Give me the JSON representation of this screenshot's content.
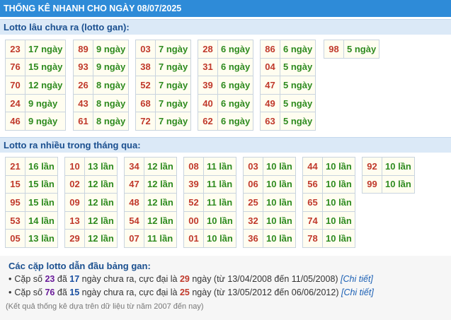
{
  "title": "THỐNG KÊ NHANH CHO NGÀY 08/07/2025",
  "gan_section": {
    "heading": "Lotto lâu chưa ra (lotto gan):",
    "groups": [
      [
        [
          "23",
          "17 ngày"
        ],
        [
          "76",
          "15 ngày"
        ],
        [
          "70",
          "12 ngày"
        ],
        [
          "24",
          "9 ngày"
        ],
        [
          "46",
          "9 ngày"
        ]
      ],
      [
        [
          "89",
          "9 ngày"
        ],
        [
          "93",
          "9 ngày"
        ],
        [
          "26",
          "8 ngày"
        ],
        [
          "43",
          "8 ngày"
        ],
        [
          "61",
          "8 ngày"
        ]
      ],
      [
        [
          "03",
          "7 ngày"
        ],
        [
          "38",
          "7 ngày"
        ],
        [
          "52",
          "7 ngày"
        ],
        [
          "68",
          "7 ngày"
        ],
        [
          "72",
          "7 ngày"
        ]
      ],
      [
        [
          "28",
          "6 ngày"
        ],
        [
          "31",
          "6 ngày"
        ],
        [
          "39",
          "6 ngày"
        ],
        [
          "40",
          "6 ngày"
        ],
        [
          "62",
          "6 ngày"
        ]
      ],
      [
        [
          "86",
          "6 ngày"
        ],
        [
          "04",
          "5 ngày"
        ],
        [
          "47",
          "5 ngày"
        ],
        [
          "49",
          "5 ngày"
        ],
        [
          "63",
          "5 ngày"
        ]
      ],
      [
        [
          "98",
          "5 ngày"
        ]
      ]
    ]
  },
  "frequent_section": {
    "heading": "Lotto ra nhiều trong tháng qua:",
    "groups": [
      [
        [
          "21",
          "16 lần"
        ],
        [
          "15",
          "15 lần"
        ],
        [
          "95",
          "15 lần"
        ],
        [
          "53",
          "14 lần"
        ],
        [
          "05",
          "13 lần"
        ]
      ],
      [
        [
          "10",
          "13 lần"
        ],
        [
          "02",
          "12 lần"
        ],
        [
          "09",
          "12 lần"
        ],
        [
          "13",
          "12 lần"
        ],
        [
          "29",
          "12 lần"
        ]
      ],
      [
        [
          "34",
          "12 lần"
        ],
        [
          "47",
          "12 lần"
        ],
        [
          "48",
          "12 lần"
        ],
        [
          "54",
          "12 lần"
        ],
        [
          "07",
          "11 lần"
        ]
      ],
      [
        [
          "08",
          "11 lần"
        ],
        [
          "39",
          "11 lần"
        ],
        [
          "52",
          "11 lần"
        ],
        [
          "00",
          "10 lần"
        ],
        [
          "01",
          "10 lần"
        ]
      ],
      [
        [
          "03",
          "10 lần"
        ],
        [
          "06",
          "10 lần"
        ],
        [
          "25",
          "10 lần"
        ],
        [
          "32",
          "10 lần"
        ],
        [
          "36",
          "10 lần"
        ]
      ],
      [
        [
          "44",
          "10 lần"
        ],
        [
          "56",
          "10 lần"
        ],
        [
          "65",
          "10 lần"
        ],
        [
          "74",
          "10 lần"
        ],
        [
          "78",
          "10 lần"
        ]
      ],
      [
        [
          "92",
          "10 lần"
        ],
        [
          "99",
          "10 lần"
        ]
      ]
    ]
  },
  "summary": {
    "heading": "Các cặp lotto dẫn đầu bảng gan:",
    "lines": [
      {
        "pre": "Cặp số ",
        "num": "23",
        "mid1": " đã ",
        "days": "17",
        "mid2": " ngày chưa ra, cực đại là ",
        "max": "29",
        "post": " ngày (từ 13/04/2008 đến 11/05/2008) ",
        "link": "[Chi tiết]"
      },
      {
        "pre": "Cặp số ",
        "num": "76",
        "mid1": " đã ",
        "days": "15",
        "mid2": " ngày chưa ra, cực đại là ",
        "max": "25",
        "post": " ngày (từ 13/05/2012 đến 06/06/2012) ",
        "link": "[Chi tiết]"
      }
    ],
    "note": "(Kết quả thống kê dựa trên dữ liệu từ năm 2007 đến nay)"
  }
}
